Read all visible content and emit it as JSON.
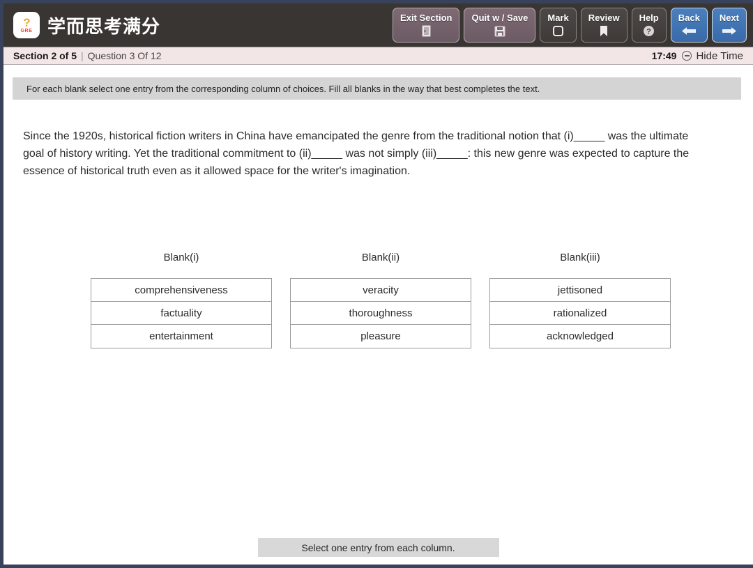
{
  "app": {
    "brand_title": "学而思考满分",
    "logo_text": "GRE",
    "logo_mark": "?"
  },
  "toolbar": {
    "buttons": [
      {
        "label": "Exit Section",
        "icon": "door-exit-icon",
        "style": "purple"
      },
      {
        "label": "Quit w / Save",
        "icon": "floppy-save-icon",
        "style": "purple"
      },
      {
        "label": "Mark",
        "icon": "checkbox-square-icon",
        "style": "gray"
      },
      {
        "label": "Review",
        "icon": "bookmark-icon",
        "style": "gray"
      },
      {
        "label": "Help",
        "icon": "question-circle-icon",
        "style": "gray"
      },
      {
        "label": "Back",
        "icon": "arrow-left-icon",
        "style": "blue"
      },
      {
        "label": "Next",
        "icon": "arrow-right-icon",
        "style": "blue"
      }
    ]
  },
  "section_bar": {
    "section_label": "Section 2 of 5",
    "divider": "|",
    "question_label": "Question 3 Of 12",
    "timer": "17:49",
    "hide_time_label": "Hide Time",
    "hide_time_icon": "minus-circle-icon"
  },
  "main": {
    "instruction": "For each blank select one entry from the corresponding column of choices. Fill all blanks in the way that best completes the text.",
    "passage": "Since the 1920s, historical fiction writers in China have emancipated the genre from the traditional notion that (i)_____ was the ultimate goal of history writing. Yet the traditional commitment to (ii)_____ was not simply (iii)_____: this new genre was expected to capture the essence of historical truth even as it allowed space for the writer's imagination.",
    "columns": [
      {
        "header": "Blank(i)",
        "choices": [
          "comprehensiveness",
          "factuality",
          "entertainment"
        ]
      },
      {
        "header": "Blank(ii)",
        "choices": [
          "veracity",
          "thoroughness",
          "pleasure"
        ]
      },
      {
        "header": "Blank(iii)",
        "choices": [
          "jettisoned",
          "rationalized",
          "acknowledged"
        ]
      }
    ],
    "bottom_note": "Select one entry from each column."
  },
  "colors": {
    "frame": "#38425a",
    "toolbar_bg": "#393533",
    "section_bg": "#f2e6e6",
    "accent_blue": "#3a6aa8",
    "accent_purple": "#6c5a64",
    "instruction_bg": "#d4d4d4"
  }
}
